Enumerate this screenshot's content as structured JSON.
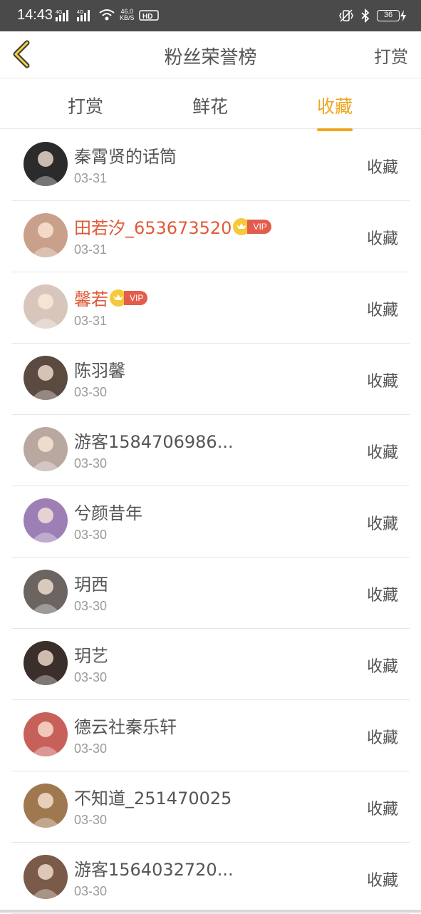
{
  "status_bar": {
    "time": "14:43",
    "net_speed_value": "46.0",
    "net_speed_unit": "KB/S",
    "signal_1": "4G",
    "signal_2": "4G",
    "hd": "HD",
    "battery": "36"
  },
  "nav": {
    "title": "粉丝荣誉榜",
    "right_label": "打赏",
    "back_icon": "chevron-left-icon"
  },
  "tabs": [
    {
      "label": "打赏",
      "active": false
    },
    {
      "label": "鲜花",
      "active": false
    },
    {
      "label": "收藏",
      "active": true
    }
  ],
  "colors": {
    "accent": "#f0a51e",
    "vip_name": "#e05a3a",
    "vip_tag": "#e35d4c",
    "text": "#555555",
    "muted": "#9a9a9a"
  },
  "vip_label": "VIP",
  "list": [
    {
      "name": "秦霄贤的话筒",
      "date": "03-31",
      "action": "收藏",
      "vip": false,
      "avatar_color": "#2b2b2b"
    },
    {
      "name": "田若汐_653673520",
      "date": "03-31",
      "action": "收藏",
      "vip": true,
      "avatar_color": "#c9a08a"
    },
    {
      "name": "馨若",
      "date": "03-31",
      "action": "收藏",
      "vip": true,
      "avatar_color": "#d8c6bd"
    },
    {
      "name": "陈羽馨",
      "date": "03-30",
      "action": "收藏",
      "vip": false,
      "avatar_color": "#5a4a40"
    },
    {
      "name": "游客1584706986...",
      "date": "03-30",
      "action": "收藏",
      "vip": false,
      "avatar_color": "#b8a8a0"
    },
    {
      "name": "兮颜昔年",
      "date": "03-30",
      "action": "收藏",
      "vip": false,
      "avatar_color": "#9d7fb6"
    },
    {
      "name": "玥西",
      "date": "03-30",
      "action": "收藏",
      "vip": false,
      "avatar_color": "#6b6460"
    },
    {
      "name": "玥艺",
      "date": "03-30",
      "action": "收藏",
      "vip": false,
      "avatar_color": "#3a2f2b"
    },
    {
      "name": "德云社秦乐轩",
      "date": "03-30",
      "action": "收藏",
      "vip": false,
      "avatar_color": "#c8605a"
    },
    {
      "name": "不知道_251470025",
      "date": "03-30",
      "action": "收藏",
      "vip": false,
      "avatar_color": "#a07850"
    },
    {
      "name": "游客1564032720...",
      "date": "03-30",
      "action": "收藏",
      "vip": false,
      "avatar_color": "#7a5a48"
    }
  ]
}
